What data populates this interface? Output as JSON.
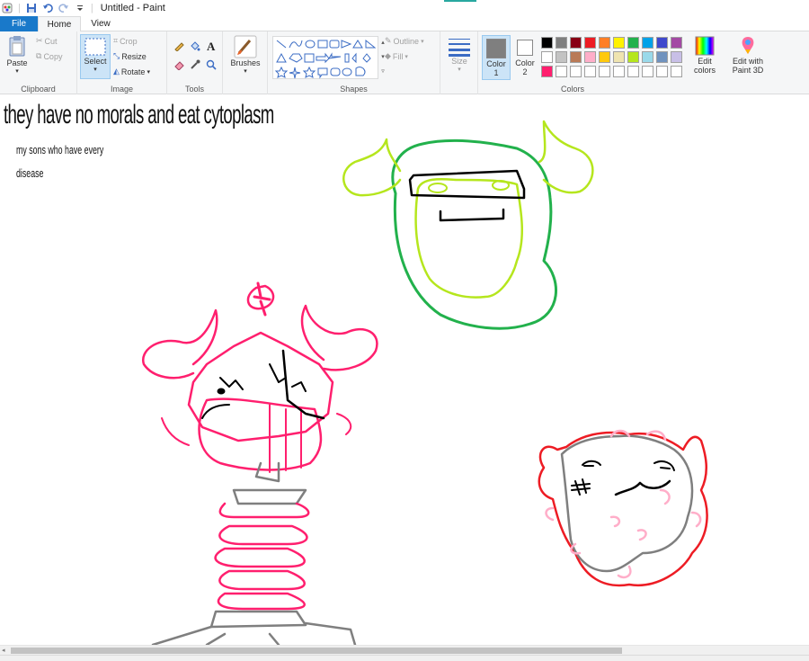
{
  "app": {
    "title": "Untitled - Paint"
  },
  "tabs": {
    "file": "File",
    "home": "Home",
    "view": "View"
  },
  "clipboard": {
    "paste": "Paste",
    "cut": "Cut",
    "copy": "Copy",
    "label": "Clipboard"
  },
  "image": {
    "select": "Select",
    "crop": "Crop",
    "resize": "Resize",
    "rotate": "Rotate",
    "label": "Image"
  },
  "tools": {
    "label": "Tools"
  },
  "brushes": {
    "label": "Brushes"
  },
  "shapes": {
    "outline": "Outline",
    "fill": "Fill",
    "label": "Shapes"
  },
  "size": {
    "label": "Size"
  },
  "colors": {
    "color1_label": "Color",
    "color1_num": "1",
    "color2_label": "Color",
    "color2_num": "2",
    "edit_line1": "Edit",
    "edit_line2": "colors",
    "paint3d_line1": "Edit with",
    "paint3d_line2": "Paint 3D",
    "label": "Colors",
    "color1_value": "#7f7f7f",
    "color2_value": "#ffffff",
    "palette_row1": [
      "#000000",
      "#7f7f7f",
      "#880015",
      "#ed1c24",
      "#ff7f27",
      "#fff200",
      "#22b14c",
      "#00a2e8",
      "#3f48cc",
      "#a349a4"
    ],
    "palette_row2": [
      "#ffffff",
      "#c3c3c3",
      "#b97a57",
      "#ffaec9",
      "#ffc90e",
      "#efe4b0",
      "#b5e61d",
      "#99d9ea",
      "#7092be",
      "#c8bfe7"
    ],
    "palette_row3_first": "#ff1f6e"
  },
  "canvas": {
    "headline": "they have no morals and eat cytoplasm",
    "sub1": "my sons who have every",
    "sub2": "disease"
  }
}
